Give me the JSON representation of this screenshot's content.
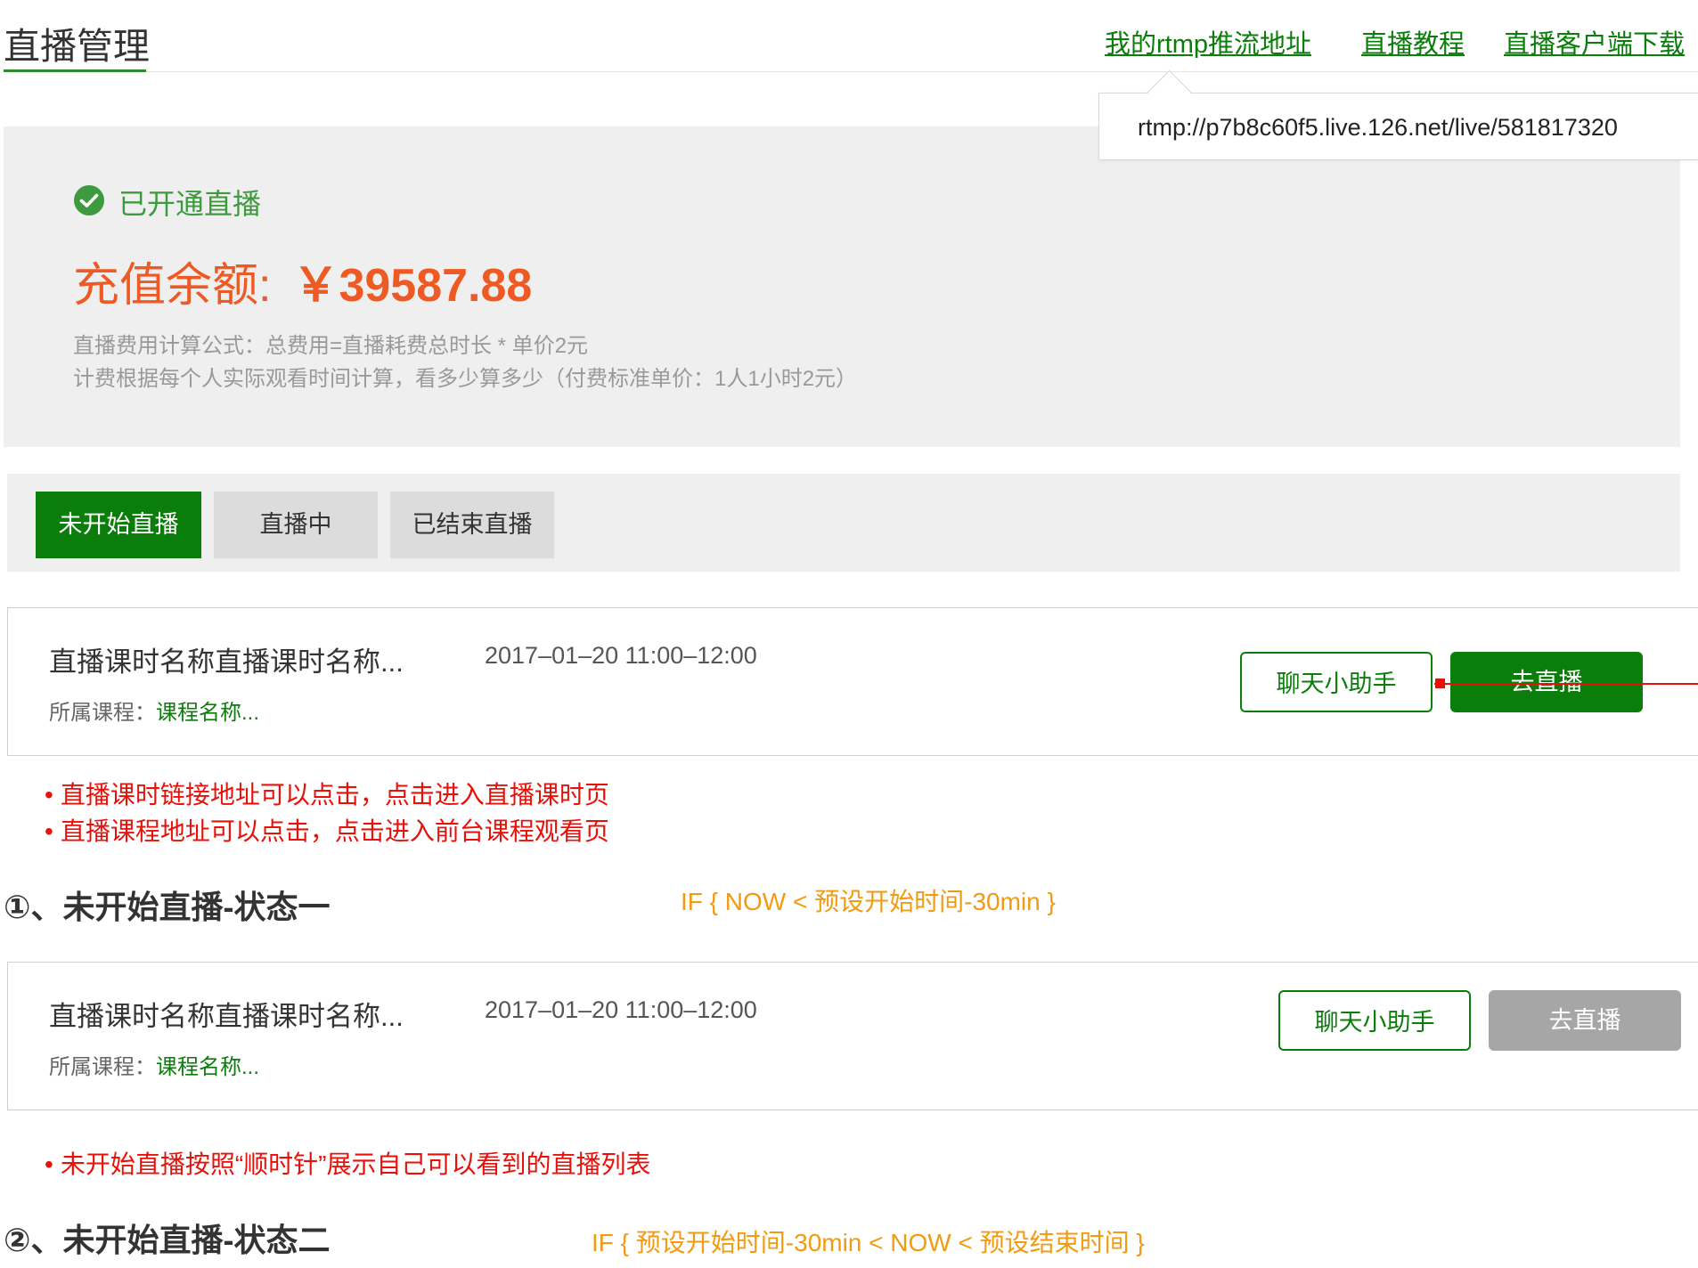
{
  "header": {
    "title": "直播管理",
    "links": [
      "我的rtmp推流地址",
      "直播教程",
      "直播客户端下载"
    ]
  },
  "rtmp_popover": {
    "url": "rtmp://p7b8c60f5.live.126.net/live/581817320"
  },
  "status": {
    "label": "已开通直播",
    "balance_label": "充值余额:",
    "balance_value": "￥39587.88",
    "formula": "直播费用计算公式：总费用=直播耗费总时长 * 单价2元",
    "billing_note": "计费根据每个人实际观看时间计算，看多少算多少（付费标准单价：1人1小时2元）"
  },
  "tabs": [
    "未开始直播",
    "直播中",
    "已结束直播"
  ],
  "active_tab_index": 0,
  "cards": [
    {
      "lesson_name": "直播课时名称直播课时名称...",
      "time": "2017–01–20 11:00–12:00",
      "course_label": "所属课程：",
      "course_name": "课程名称...",
      "chat_button": "聊天小助手",
      "live_button": "去直播",
      "live_enabled": true
    },
    {
      "lesson_name": "直播课时名称直播课时名称...",
      "time": "2017–01–20 11:00–12:00",
      "course_label": "所属课程：",
      "course_name": "课程名称...",
      "chat_button": "聊天小助手",
      "live_button": "去直播",
      "live_enabled": false
    }
  ],
  "notes_state1": [
    "直播课时链接地址可以点击，点击进入直播课时页",
    "直播课程地址可以点击，点击进入前台课程观看页"
  ],
  "state1": {
    "heading": "①、未开始直播-状态一",
    "condition": "IF { NOW < 预设开始时间-30min }"
  },
  "notes_state2": [
    "未开始直播按照“顺时针”展示自己可以看到的直播列表"
  ],
  "state2": {
    "heading": "②、未开始直播-状态二",
    "condition": "IF { 预设开始时间-30min < NOW < 预设结束时间 }"
  },
  "colors": {
    "brand_green": "#0a7d0a",
    "balance_orange": "#ee5a24",
    "note_red": "#e8110a",
    "condition_orange": "#f29a10",
    "disabled_gray": "#a6a6a6",
    "panel_bg": "#efefef"
  },
  "icons": {
    "status": "check-circle-icon"
  }
}
